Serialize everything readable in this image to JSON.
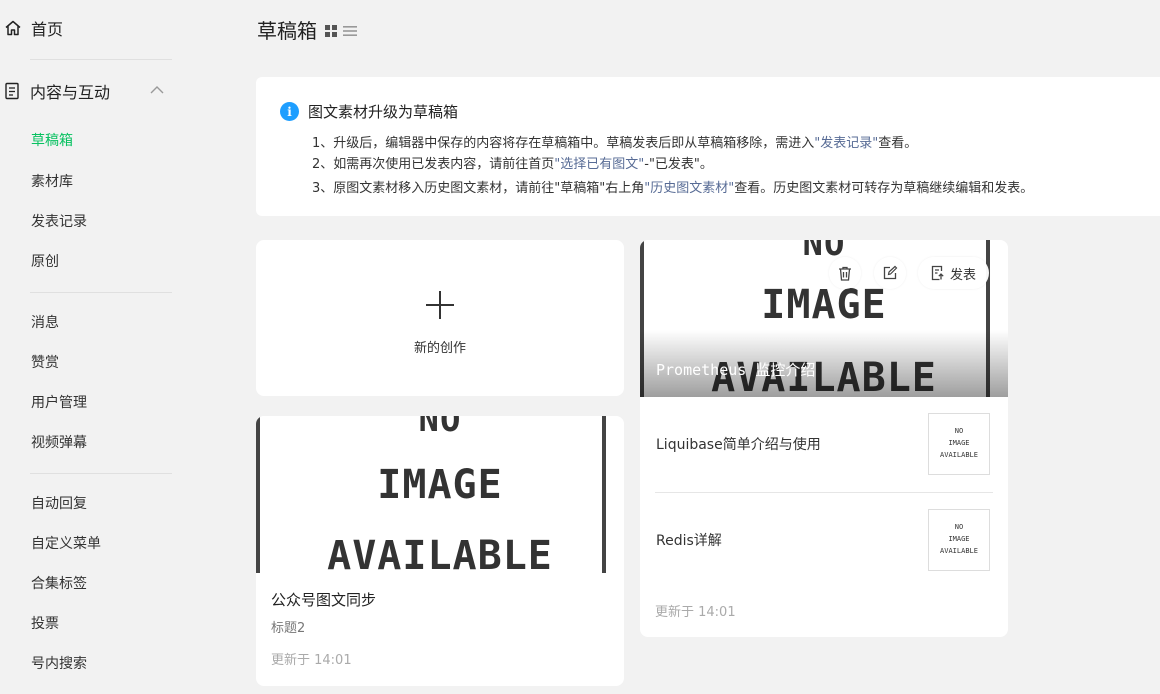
{
  "sidebar": {
    "home": "首页",
    "group": "内容与互动",
    "items1": [
      "草稿箱",
      "素材库",
      "发表记录",
      "原创"
    ],
    "items2": [
      "消息",
      "赞赏",
      "用户管理",
      "视频弹幕"
    ],
    "items3": [
      "自动回复",
      "自定义菜单",
      "合集标签",
      "投票",
      "号内搜索"
    ]
  },
  "header": {
    "title": "草稿箱"
  },
  "notice": {
    "title": "图文素材升级为草稿箱",
    "line1_a": "1、升级后，编辑器中保存的内容将存在草稿箱中。草稿发表后即从草稿箱移除，需进入",
    "line1_link": "\"发表记录\"",
    "line1_b": "查看。",
    "line2_a": "2、如需再次使用已发表内容，请前往首页",
    "line2_link": "\"选择已有图文\"",
    "line2_b": "-\"已发表\"。",
    "line3_a": "3、原图文素材移入历史图文素材，请前往\"草稿箱\"右上角",
    "line3_link": "\"历史图文素材\"",
    "line3_b": "查看。历史图文素材可转存为草稿继续编辑和发表。"
  },
  "new_card": {
    "label": "新的创作"
  },
  "placeholder": {
    "no": "NO",
    "image": "IMAGE",
    "available": "AVAILABLE"
  },
  "draft_single": {
    "title": "公众号图文同步",
    "subtitle": "标题2",
    "updated": "更新于 14:01"
  },
  "draft_multi": {
    "cover_title": "Prometheus 监控介绍",
    "publish_label": "发表",
    "items": [
      {
        "title": "Liquibase简单介绍与使用"
      },
      {
        "title": "Redis详解"
      }
    ],
    "updated": "更新于 14:01"
  }
}
